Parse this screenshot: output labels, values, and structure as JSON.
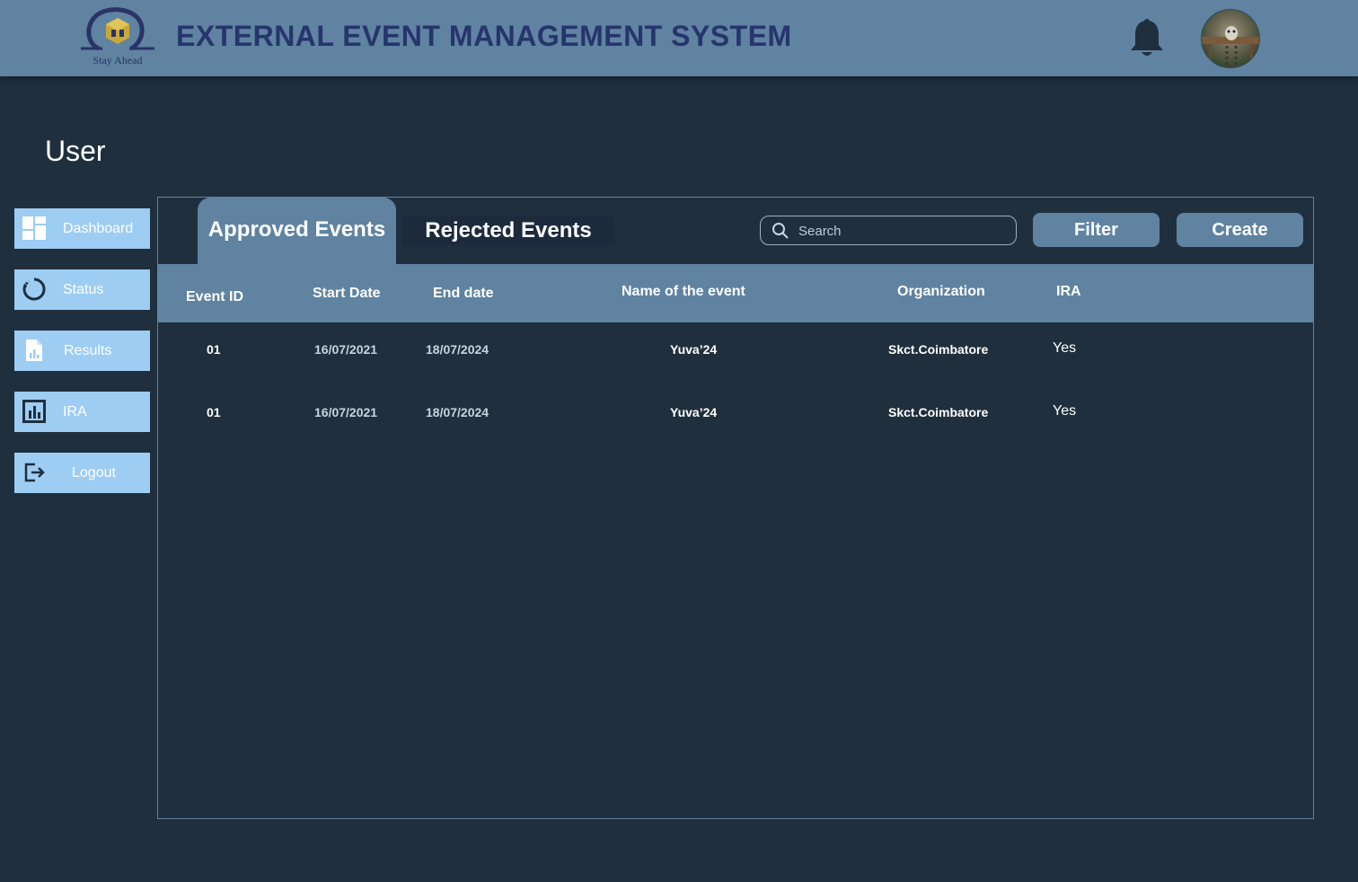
{
  "header": {
    "logo_tagline": "Stay Ahead",
    "title": "EXTERNAL EVENT MANAGEMENT SYSTEM",
    "bell_icon": "bell-icon",
    "avatar_icon": "user-avatar"
  },
  "page": {
    "title": "User"
  },
  "sidebar": {
    "items": [
      {
        "label": "Dashboard",
        "icon": "dashboard-icon"
      },
      {
        "label": "Status",
        "icon": "status-icon"
      },
      {
        "label": "Results",
        "icon": "results-icon"
      },
      {
        "label": "IRA",
        "icon": "chart-icon"
      },
      {
        "label": "Logout",
        "icon": "logout-icon"
      }
    ]
  },
  "main": {
    "tabs": [
      {
        "label": "Approved Events",
        "active": true
      },
      {
        "label": "Rejected Events",
        "active": false
      }
    ],
    "search": {
      "placeholder": "Search",
      "value": ""
    },
    "filter_label": "Filter",
    "create_label": "Create",
    "table": {
      "columns": [
        "Event  ID",
        "Start Date",
        "End date",
        "Name of the event",
        "Organization",
        "IRA"
      ],
      "rows": [
        [
          "01",
          "16/07/2021",
          "18/07/2024",
          "Yuva’24",
          "Skct.Coimbatore",
          "Yes"
        ],
        [
          "01",
          "16/07/2021",
          "18/07/2024",
          "Yuva’24",
          "Skct.Coimbatore",
          "Yes"
        ]
      ]
    }
  },
  "colors": {
    "background": "#1f2f3e",
    "header": "#5f83a1",
    "sidebar_item": "#9dcdf2",
    "title_text": "#26356b"
  }
}
